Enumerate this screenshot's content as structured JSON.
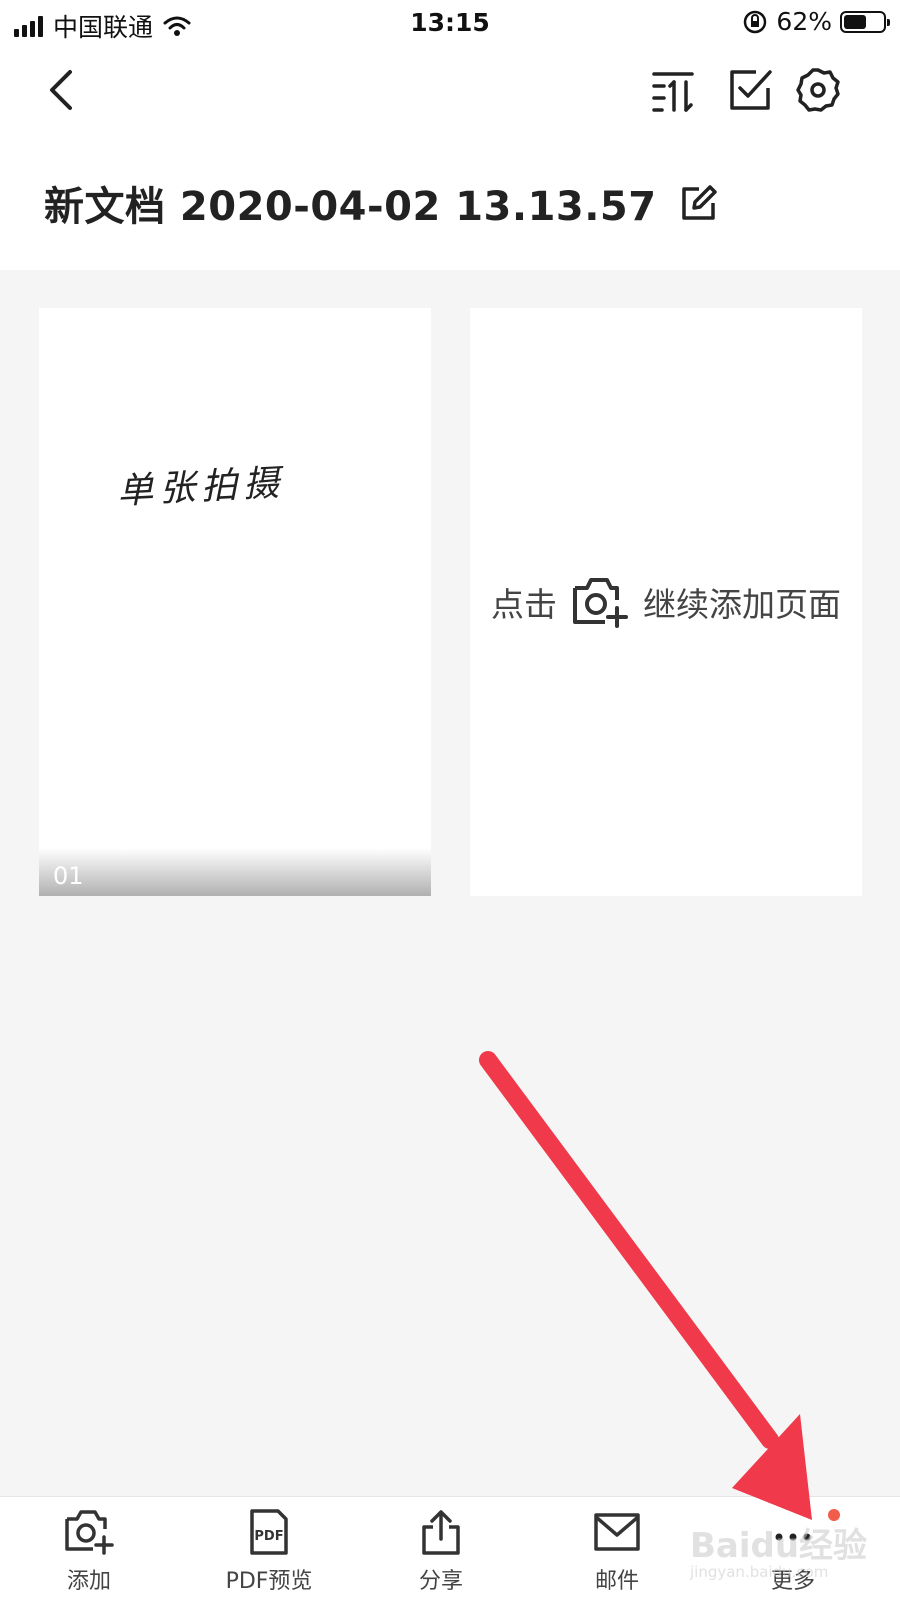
{
  "status_bar": {
    "carrier": "中国联通",
    "time": "13:15",
    "battery_percent": "62%",
    "battery_level": 0.62
  },
  "header": {
    "back_icon": "chevron-left-icon",
    "sort_icon": "sort-icon",
    "select_icon": "checkbox-icon",
    "settings_icon": "gear-icon",
    "title": "新文档 2020-04-02 13.13.57",
    "edit_icon": "edit-icon"
  },
  "pages": {
    "page1": {
      "handwriting": "单张拍摄",
      "number": "01"
    },
    "add_page": {
      "prefix": "点击",
      "icon": "camera-plus-icon",
      "suffix": "继续添加页面"
    }
  },
  "bottom_bar": {
    "items": [
      {
        "label": "添加",
        "icon": "camera-plus-icon"
      },
      {
        "label": "PDF预览",
        "icon": "pdf-icon"
      },
      {
        "label": "分享",
        "icon": "share-icon"
      },
      {
        "label": "邮件",
        "icon": "mail-icon"
      },
      {
        "label": "更多",
        "icon": "more-icon"
      }
    ]
  },
  "watermark": {
    "brand": "Baidu经验",
    "url": "jingyan.baidu.com"
  },
  "colors": {
    "accent_arrow": "#f0394a",
    "notification_dot": "#f25c4a",
    "background": "#f5f5f5"
  }
}
